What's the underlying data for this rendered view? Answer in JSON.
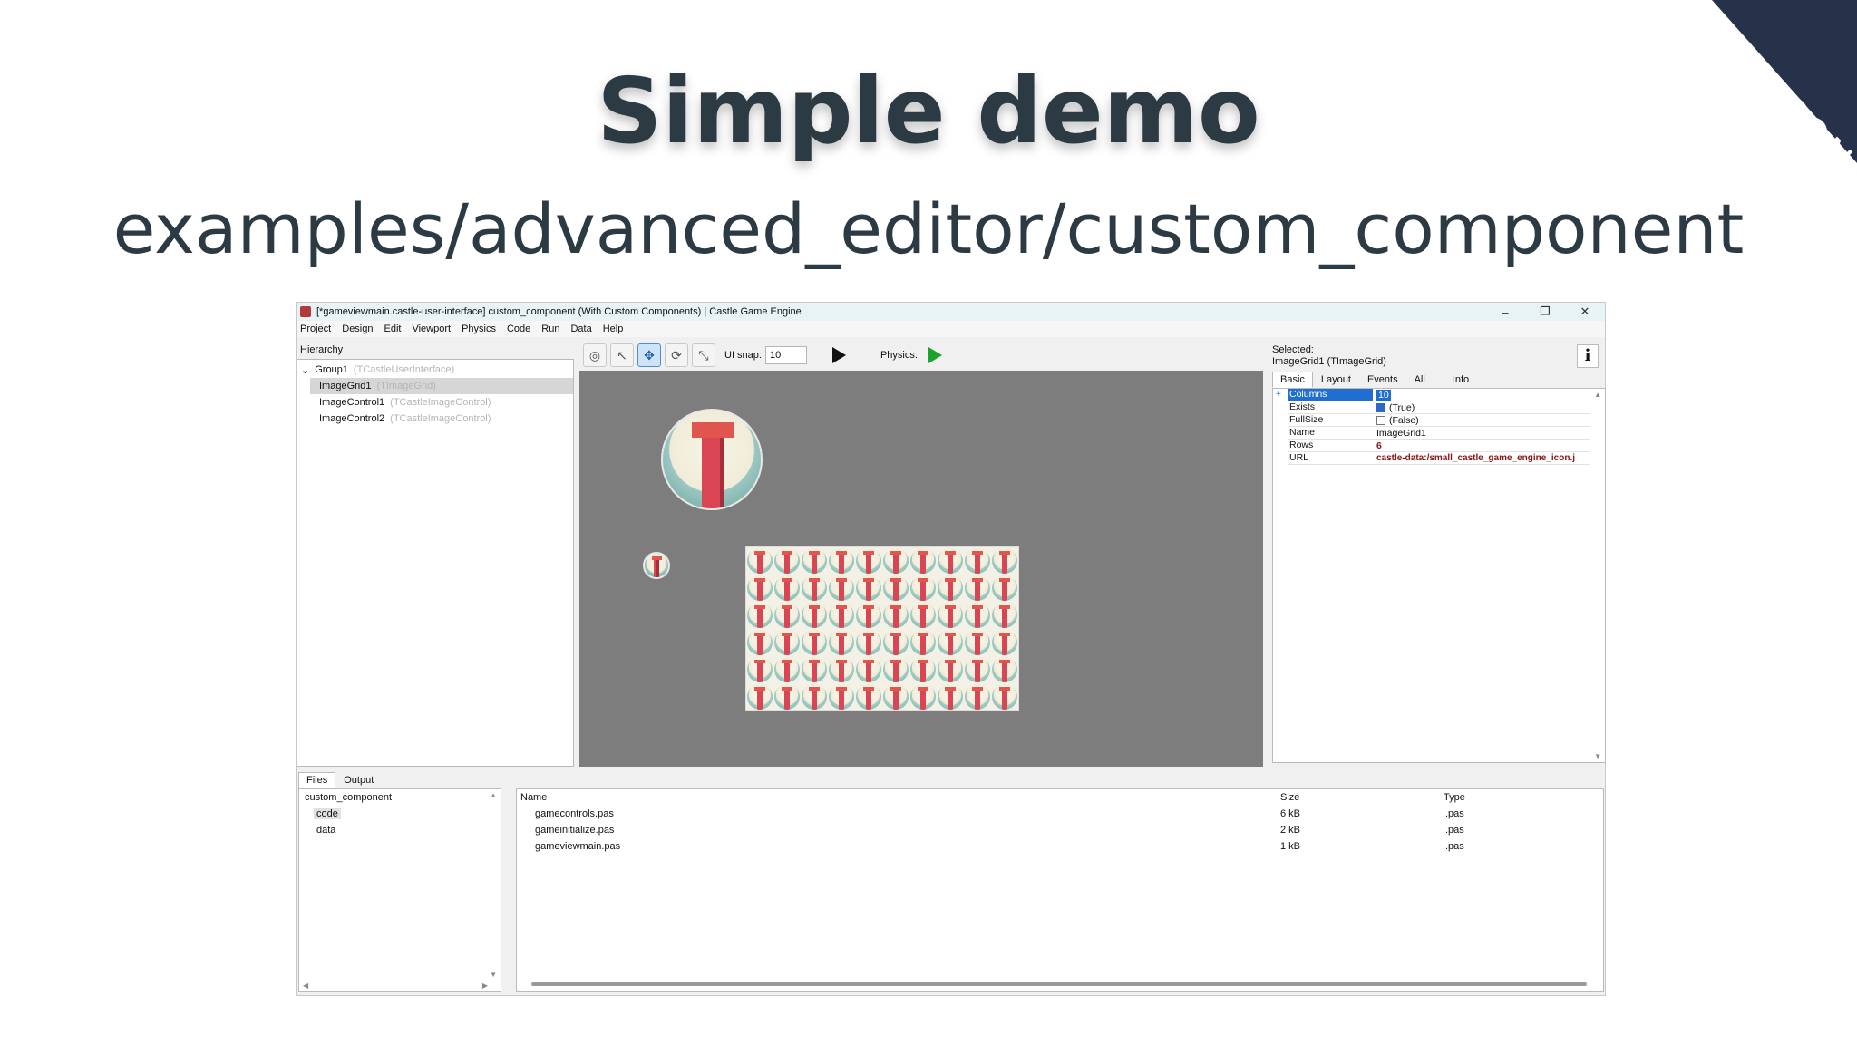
{
  "corner_logo": "itDEVCON",
  "title": "Simple demo",
  "subtitle": "examples/advanced_editor/custom_component",
  "window": {
    "title": "[*gameviewmain.castle-user-interface] custom_component (With Custom Components) | Castle Game Engine",
    "controls": {
      "minimize": "–",
      "maximize": "❐",
      "close": "✕"
    },
    "menu": [
      "Project",
      "Design",
      "Edit",
      "Viewport",
      "Physics",
      "Code",
      "Run",
      "Data",
      "Help"
    ]
  },
  "hierarchy": {
    "label": "Hierarchy",
    "items": [
      {
        "name": "Group1",
        "cls": "(TCastleUserInterface)"
      },
      {
        "name": "ImageGrid1",
        "cls": "(TImageGrid)"
      },
      {
        "name": "ImageControl1",
        "cls": "(TCastleImageControl)"
      },
      {
        "name": "ImageControl2",
        "cls": "(TCastleImageControl)"
      }
    ]
  },
  "toolbar": {
    "ui_snap_label": "UI snap:",
    "ui_snap_value": "10",
    "physics_label": "Physics:"
  },
  "inspector": {
    "selected_label": "Selected:",
    "selected_value": "ImageGrid1 (TImageGrid)",
    "tabs": [
      "Basic",
      "Layout",
      "Events",
      "All",
      "Info"
    ],
    "info_button": "i",
    "properties": [
      {
        "key": "Columns",
        "value": "10"
      },
      {
        "key": "Exists",
        "value": "(True)"
      },
      {
        "key": "FullSize",
        "value": "(False)"
      },
      {
        "key": "Name",
        "value": "ImageGrid1"
      },
      {
        "key": "Rows",
        "value": "6"
      },
      {
        "key": "URL",
        "value": "castle-data:/small_castle_game_engine_icon.j"
      }
    ]
  },
  "bottom": {
    "tabs": [
      "Files",
      "Output"
    ],
    "tree": [
      "custom_component",
      "code",
      "data"
    ],
    "columns": [
      "Name",
      "Size",
      "Type"
    ],
    "files": [
      {
        "name": "gamecontrols.pas",
        "size": "6 kB",
        "type": ".pas"
      },
      {
        "name": "gameinitialize.pas",
        "size": "2 kB",
        "type": ".pas"
      },
      {
        "name": "gameviewmain.pas",
        "size": "1 kB",
        "type": ".pas"
      }
    ]
  },
  "image_grid": {
    "columns": 10,
    "rows": 6
  }
}
